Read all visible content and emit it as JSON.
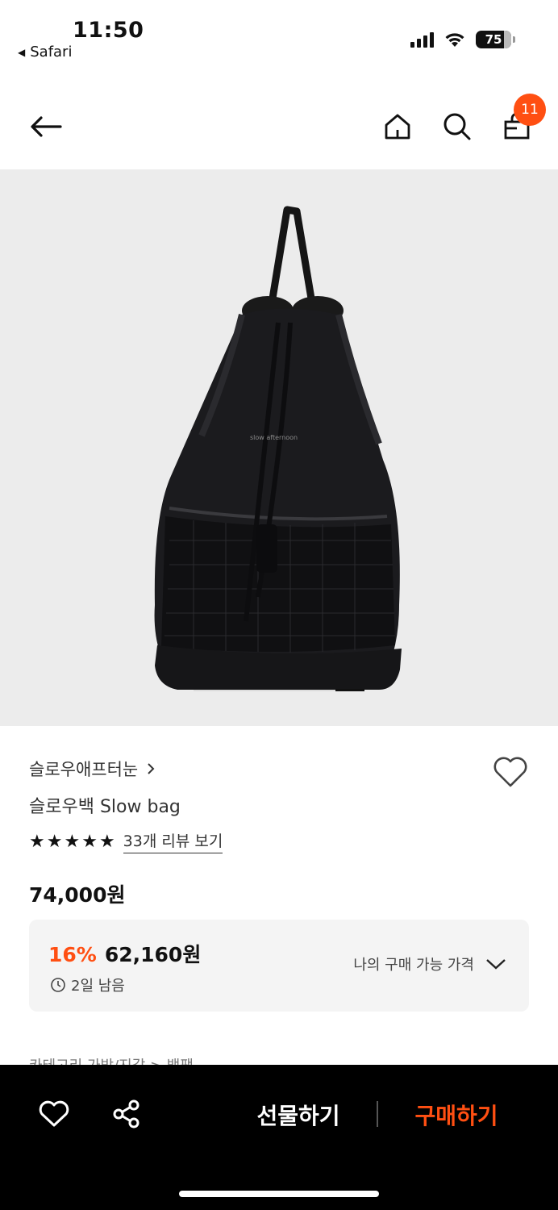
{
  "status": {
    "time": "11:50",
    "back_app": "Safari",
    "battery": "75"
  },
  "header": {
    "cart_count": "11"
  },
  "product": {
    "brand": "슬로우애프터눈",
    "name": "슬로우백 Slow bag",
    "rating_stars": 5,
    "review_link": "33개 리뷰 보기",
    "original_price": "74,000원",
    "discount_rate": "16%",
    "discount_price": "62,160원",
    "time_left": "2일 남음",
    "my_price_label": "나의 구매 가능 가격"
  },
  "partial_text": "카테고리   가방/지갑 > 백팩",
  "bottom_bar": {
    "gift_label": "선물하기",
    "buy_label": "구매하기"
  },
  "colors": {
    "accent": "#ff4f12",
    "image_bg": "#ececec",
    "bottom_bar_bg": "#000000"
  }
}
